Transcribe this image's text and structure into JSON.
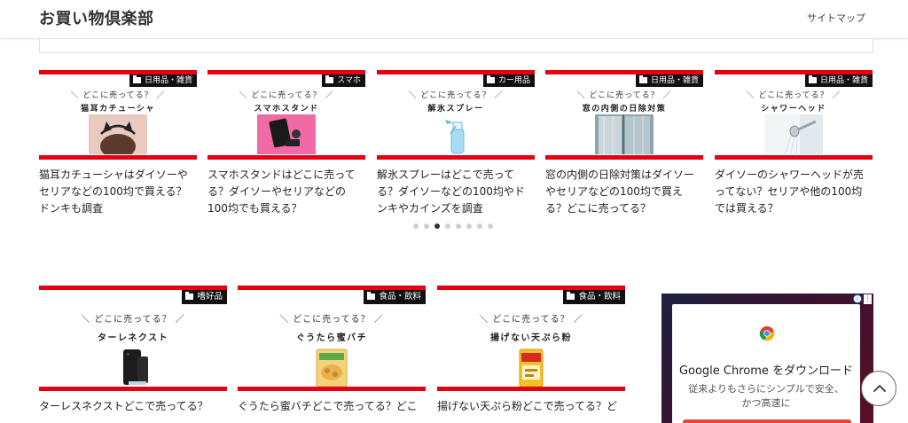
{
  "header": {
    "site_title": "お買い物倶楽部",
    "sitemap_label": "サイトマップ"
  },
  "carousel": {
    "cards": [
      {
        "category": "日用品・雑貨",
        "tagline": "＼ どこに売ってる？ ／",
        "item": "猫耳カチューシャ",
        "title": "猫耳カチューシャはダイソーやセリアなどの100均で買える？ドンキも調査"
      },
      {
        "category": "スマホ",
        "tagline": "＼ どこに売ってる？ ／",
        "item": "スマホスタンド",
        "title": "スマホスタンドはどこに売ってる？ダイソーやセリアなどの100均でも買える？"
      },
      {
        "category": "カー用品",
        "tagline": "＼ どこに売ってる？ ／",
        "item": "解氷スプレー",
        "title": "解氷スプレーはどこで売ってる？ダイソーなどの100均やドンキやカインズを調査"
      },
      {
        "category": "日用品・雑貨",
        "tagline": "＼ どこに売ってる？ ／",
        "item": "窓の内側の日除対策",
        "title": "窓の内側の日除対策はダイソーやセリアなどの100均で買える？どこに売ってる？"
      },
      {
        "category": "日用品・雑貨",
        "tagline": "＼ どこに売ってる？ ／",
        "item": "シャワーヘッド",
        "title": "ダイソーのシャワーヘッドが売ってない？セリアや他の100均では買える？"
      }
    ],
    "dot_count": 8,
    "active_dot": 2
  },
  "grid": {
    "cards": [
      {
        "category": "嗜好品",
        "tagline": "＼ どこに売ってる？ ／",
        "item": "ターレネクスト",
        "title": "ターレスネクストどこで売ってる？"
      },
      {
        "category": "食品・飲料",
        "tagline": "＼ どこに売ってる？ ／",
        "item": "ぐうたら蜜バチ",
        "title": "ぐうたら蜜バチどこで売ってる？どこ"
      },
      {
        "category": "食品・飲料",
        "tagline": "＼ どこに売ってる？ ／",
        "item": "揚げない天ぷら粉",
        "title": "揚げない天ぷら粉どこで売ってる？ど"
      }
    ]
  },
  "ad": {
    "headline": "Google Chrome をダウンロード",
    "body_line1": "従来よりもさらにシンプルで安全、",
    "body_line2": "かつ高速に",
    "info_icon": "info-icon",
    "menu_icon": "ad-options-icon"
  },
  "colors": {
    "accent_red": "#e60012",
    "badge_bg": "#111111",
    "dot_active": "#333333",
    "dot_inactive": "#d0d0d0"
  }
}
